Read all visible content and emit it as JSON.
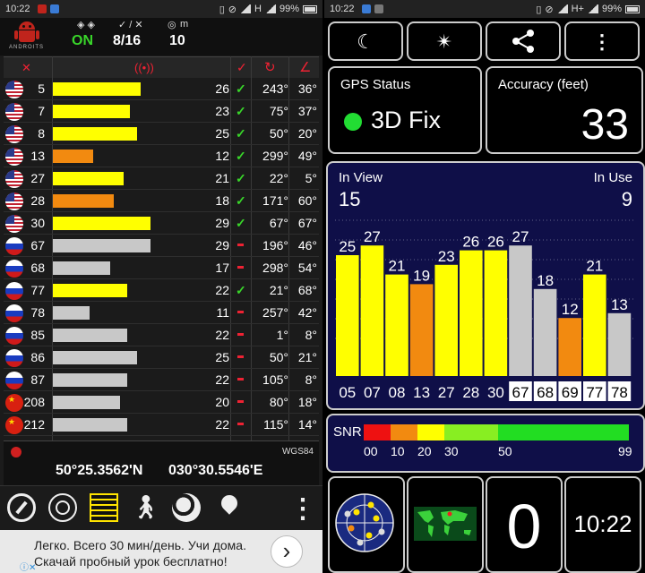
{
  "left_status": {
    "time": "10:22",
    "network": "H",
    "battery": "99%"
  },
  "right_status": {
    "time": "10:22",
    "network": "H+",
    "battery": "99%"
  },
  "header": {
    "app_logo": "ANDROITS",
    "gps_state": "ON",
    "sats_label_icon": "check-slash-icon",
    "sats": "8/16",
    "alt_unit": "m",
    "altitude": "10"
  },
  "table_headers": {
    "col_id": "satellite-icon",
    "col_signal": "signal-icon",
    "col_used": "✓",
    "col_azimuth": "azimuth-icon",
    "col_elevation": "elevation-icon"
  },
  "satellites": [
    {
      "flag": "us",
      "id": "5",
      "snr": 26,
      "used": true,
      "az": "243°",
      "el": "36°",
      "color": "#ffff00"
    },
    {
      "flag": "us",
      "id": "7",
      "snr": 23,
      "used": true,
      "az": "75°",
      "el": "37°",
      "color": "#ffff00"
    },
    {
      "flag": "us",
      "id": "8",
      "snr": 25,
      "used": true,
      "az": "50°",
      "el": "20°",
      "color": "#ffff00"
    },
    {
      "flag": "us",
      "id": "13",
      "snr": 12,
      "used": true,
      "az": "299°",
      "el": "49°",
      "color": "#f28a10"
    },
    {
      "flag": "us",
      "id": "27",
      "snr": 21,
      "used": true,
      "az": "22°",
      "el": "5°",
      "color": "#ffff00"
    },
    {
      "flag": "us",
      "id": "28",
      "snr": 18,
      "used": true,
      "az": "171°",
      "el": "60°",
      "color": "#f28a10"
    },
    {
      "flag": "us",
      "id": "30",
      "snr": 29,
      "used": true,
      "az": "67°",
      "el": "67°",
      "color": "#ffff00"
    },
    {
      "flag": "ru",
      "id": "67",
      "snr": 29,
      "used": false,
      "az": "196°",
      "el": "46°",
      "color": "#c8c8c8"
    },
    {
      "flag": "ru",
      "id": "68",
      "snr": 17,
      "used": false,
      "az": "298°",
      "el": "54°",
      "color": "#c8c8c8"
    },
    {
      "flag": "ru",
      "id": "77",
      "snr": 22,
      "used": true,
      "az": "21°",
      "el": "68°",
      "color": "#ffff00"
    },
    {
      "flag": "ru",
      "id": "78",
      "snr": 11,
      "used": false,
      "az": "257°",
      "el": "42°",
      "color": "#c8c8c8"
    },
    {
      "flag": "ru",
      "id": "85",
      "snr": 22,
      "used": false,
      "az": "1°",
      "el": "8°",
      "color": "#c8c8c8"
    },
    {
      "flag": "ru",
      "id": "86",
      "snr": 25,
      "used": false,
      "az": "50°",
      "el": "21°",
      "color": "#c8c8c8"
    },
    {
      "flag": "ru",
      "id": "87",
      "snr": 22,
      "used": false,
      "az": "105°",
      "el": "8°",
      "color": "#c8c8c8"
    },
    {
      "flag": "cn",
      "id": "208",
      "snr": 20,
      "used": false,
      "az": "80°",
      "el": "18°",
      "color": "#c8c8c8"
    },
    {
      "flag": "cn",
      "id": "212",
      "snr": 22,
      "used": false,
      "az": "115°",
      "el": "14°",
      "color": "#c8c8c8"
    }
  ],
  "coords": {
    "datum": "WGS84",
    "lat": "50°25.3562'N",
    "lon": "030°30.5546'E"
  },
  "bottom_icons": [
    "compass-icon",
    "radar-icon",
    "ruler-icon",
    "walk-icon",
    "globe-icon",
    "location-pin-icon",
    "more-vert-icon"
  ],
  "ad": {
    "line1": "Легко. Всего 30 мин/день. Учи дома.",
    "line2": "Скачай пробный урок бесплатно!",
    "button": "›"
  },
  "top_buttons": [
    {
      "name": "night-mode-button",
      "glyph": "☾"
    },
    {
      "name": "compass-rose-button",
      "glyph": "✴"
    },
    {
      "name": "share-button",
      "glyph": "⋖"
    },
    {
      "name": "more-button",
      "glyph": "⋮"
    }
  ],
  "gps_status": {
    "title": "GPS Status",
    "value": "3D Fix",
    "color": "#22dd33"
  },
  "accuracy": {
    "title": "Accuracy (feet)",
    "value": "33"
  },
  "chart_data": {
    "type": "bar",
    "in_view_label": "In View",
    "in_view": "15",
    "in_use_label": "In Use",
    "in_use": "9",
    "categories": [
      "05",
      "07",
      "08",
      "13",
      "27",
      "28",
      "30",
      "67",
      "68",
      "69",
      "77",
      "78"
    ],
    "values": [
      25,
      27,
      21,
      19,
      23,
      26,
      26,
      27,
      18,
      12,
      21,
      13
    ],
    "colors": [
      "#ffff00",
      "#ffff00",
      "#ffff00",
      "#f28a10",
      "#ffff00",
      "#ffff00",
      "#ffff00",
      "#c8c8c8",
      "#c8c8c8",
      "#f28a10",
      "#ffff00",
      "#c8c8c8"
    ],
    "boxed": [
      false,
      false,
      false,
      false,
      false,
      false,
      false,
      true,
      true,
      true,
      true,
      true
    ],
    "ylim": [
      0,
      40
    ]
  },
  "snr_scale": {
    "label": "SNR",
    "ticks": [
      "00",
      "10",
      "20",
      "30",
      "50",
      "99"
    ],
    "colors": [
      "#ee1111",
      "#f28a10",
      "#ffff00",
      "#88ee22",
      "#22dd22"
    ]
  },
  "bottom_tiles": {
    "speed": "0",
    "clock": "10:22"
  }
}
